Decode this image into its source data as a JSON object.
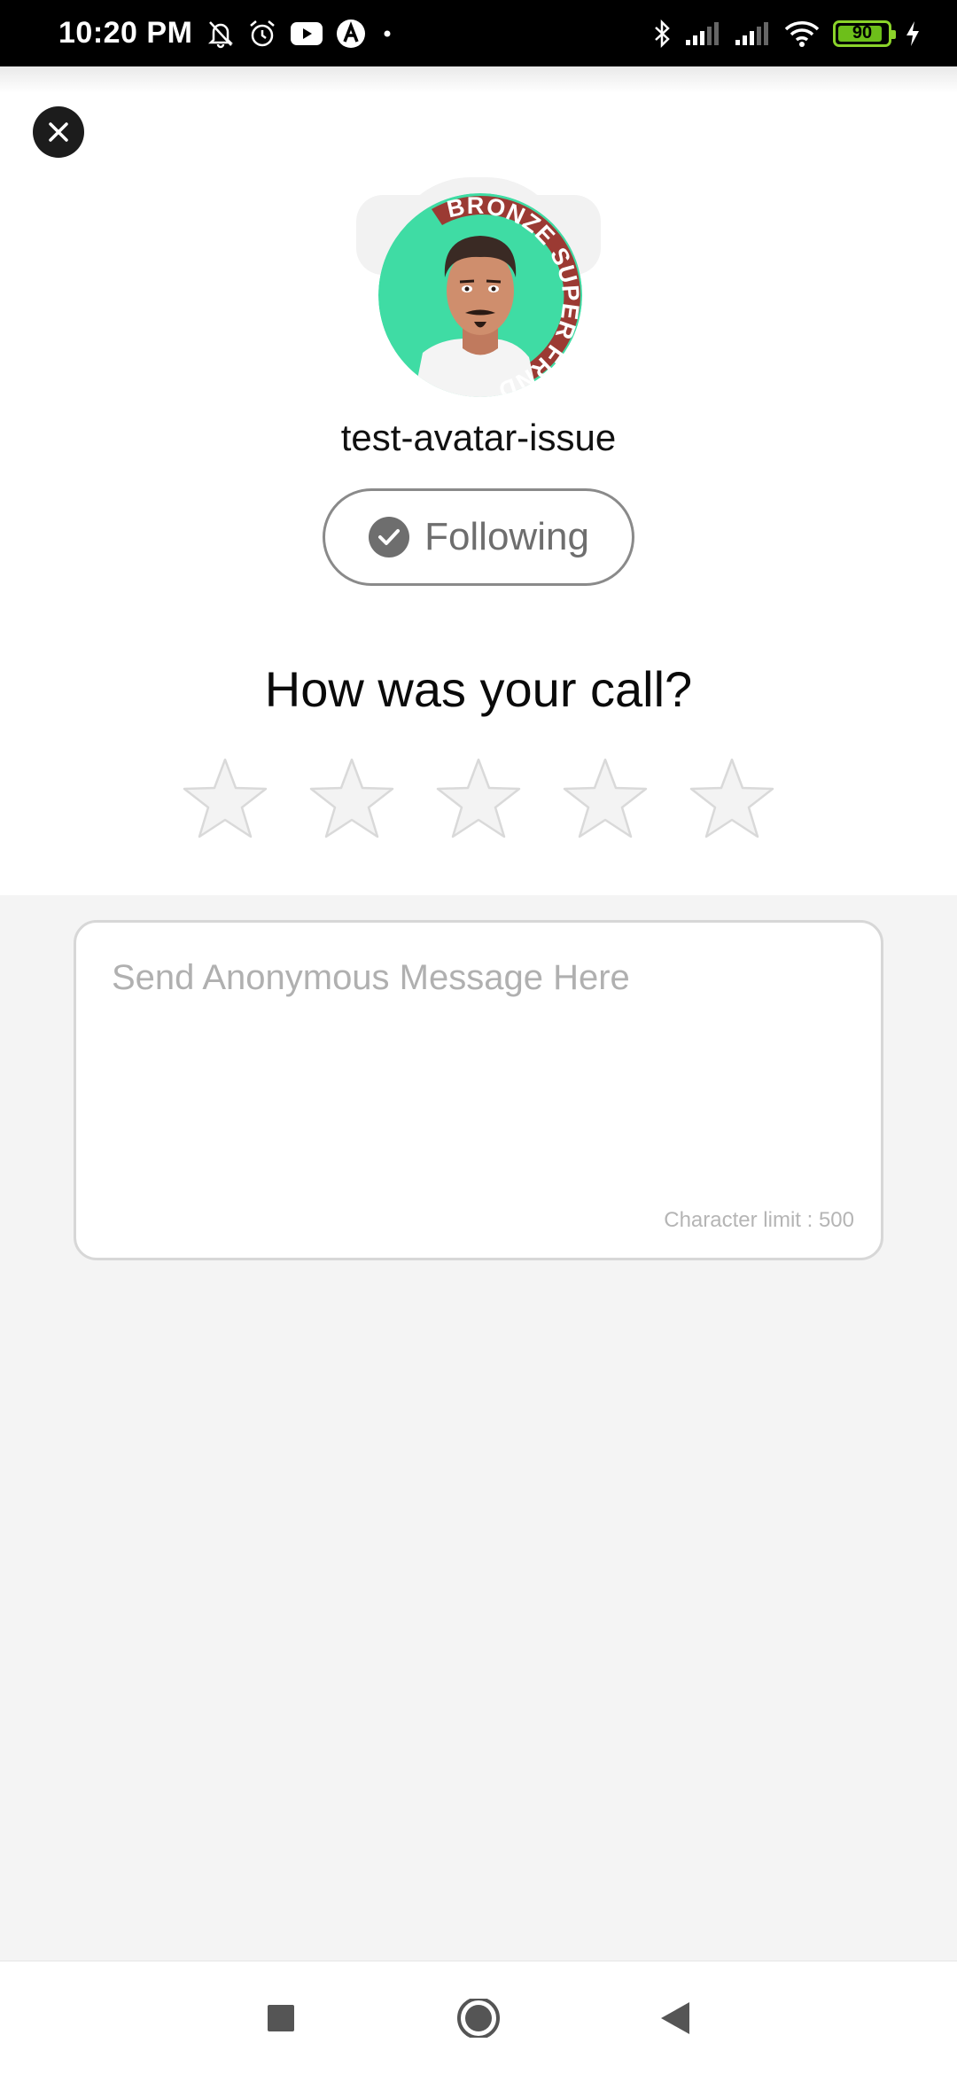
{
  "status_bar": {
    "time": "10:20 PM",
    "battery": "90",
    "battery_level": 0.9,
    "icons": [
      "bell-off-icon",
      "alarm-icon",
      "youtube-icon",
      "app-icon",
      "dot-icon",
      "bluetooth-icon",
      "signal-icon",
      "signal-icon",
      "wifi-icon",
      "battery-icon",
      "charging-icon"
    ]
  },
  "profile": {
    "username": "test-avatar-issue",
    "badge_text": "BRONZE SUPER FRND",
    "follow_label": "Following"
  },
  "rating": {
    "question": "How was your call?",
    "stars_total": 5,
    "stars_selected": 0
  },
  "message": {
    "placeholder": "Send Anonymous Message Here",
    "value": "",
    "char_limit_text": "Character limit : 500"
  },
  "colors": {
    "avatar_bg": "#3fdca4",
    "badge_ring": "#9b3a33",
    "follow_check": "#6e6e6e",
    "star_fill": "#f3f3f3",
    "star_stroke": "#d9d9d9"
  },
  "nav": [
    "recents-button",
    "home-button",
    "back-button"
  ]
}
